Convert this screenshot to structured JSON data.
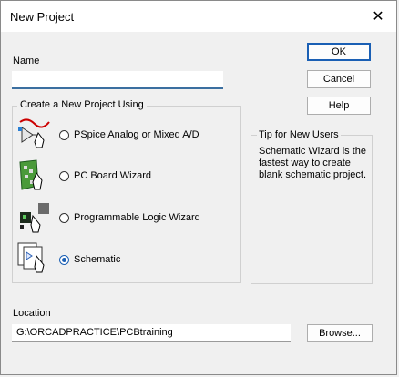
{
  "window": {
    "title": "New Project",
    "close": "✕"
  },
  "name_label": "Name",
  "name_value": "",
  "group_label": "Create a New Project Using",
  "options": [
    {
      "label": "PSpice Analog or Mixed A/D",
      "icon": "pspice-icon",
      "selected": false
    },
    {
      "label": "PC Board Wizard",
      "icon": "pcb-icon",
      "selected": false
    },
    {
      "label": "Programmable Logic Wizard",
      "icon": "logic-icon",
      "selected": false
    },
    {
      "label": "Schematic",
      "icon": "schematic-icon",
      "selected": true
    }
  ],
  "buttons": {
    "ok": "OK",
    "cancel": "Cancel",
    "help": "Help",
    "browse": "Browse..."
  },
  "tip": {
    "label": "Tip for New Users",
    "text": "Schematic Wizard is the fastest way to create blank schematic project."
  },
  "location_label": "Location",
  "location_value": "G:\\ORCADPRACTICE\\PCBtraining",
  "colors": {
    "accent": "#1a5fb4",
    "background": "#f0f0f0"
  }
}
